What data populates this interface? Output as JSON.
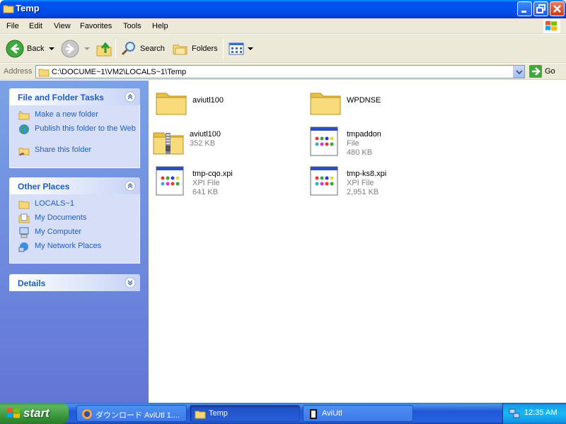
{
  "window": {
    "title": "Temp"
  },
  "menu": [
    "File",
    "Edit",
    "View",
    "Favorites",
    "Tools",
    "Help"
  ],
  "toolbar": {
    "back": "Back",
    "search": "Search",
    "folders": "Folders"
  },
  "address": {
    "label": "Address",
    "path": "C:\\DOCUME~1\\VM2\\LOCALS~1\\Temp",
    "go": "Go"
  },
  "tasks_panel": {
    "title": "File and Folder Tasks",
    "items": [
      "Make a new folder",
      "Publish this folder to the Web",
      "Share this folder"
    ]
  },
  "places_panel": {
    "title": "Other Places",
    "items": [
      "LOCALS~1",
      "My Documents",
      "My Computer",
      "My Network Places"
    ]
  },
  "details_panel": {
    "title": "Details"
  },
  "files": [
    {
      "name": "aviutl100",
      "type": "",
      "size": "",
      "icon": "folder-icon"
    },
    {
      "name": "WPDNSE",
      "type": "",
      "size": "",
      "icon": "folder-icon"
    },
    {
      "name": "aviutl100",
      "type": "",
      "size": "352 KB",
      "icon": "zip-folder-icon"
    },
    {
      "name": "tmpaddon",
      "type": "File",
      "size": "480 KB",
      "icon": "generic-file-icon"
    },
    {
      "name": "tmp-cqo.xpi",
      "type": "XPI File",
      "size": "641 KB",
      "icon": "generic-file-icon"
    },
    {
      "name": "tmp-ks8.xpi",
      "type": "XPI File",
      "size": "2,951 KB",
      "icon": "generic-file-icon"
    }
  ],
  "taskbar": {
    "start": "start",
    "tasks": [
      "ダウンロード AviUtl 1....",
      "Temp",
      "AviUtl"
    ],
    "clock": "12:35 AM"
  }
}
